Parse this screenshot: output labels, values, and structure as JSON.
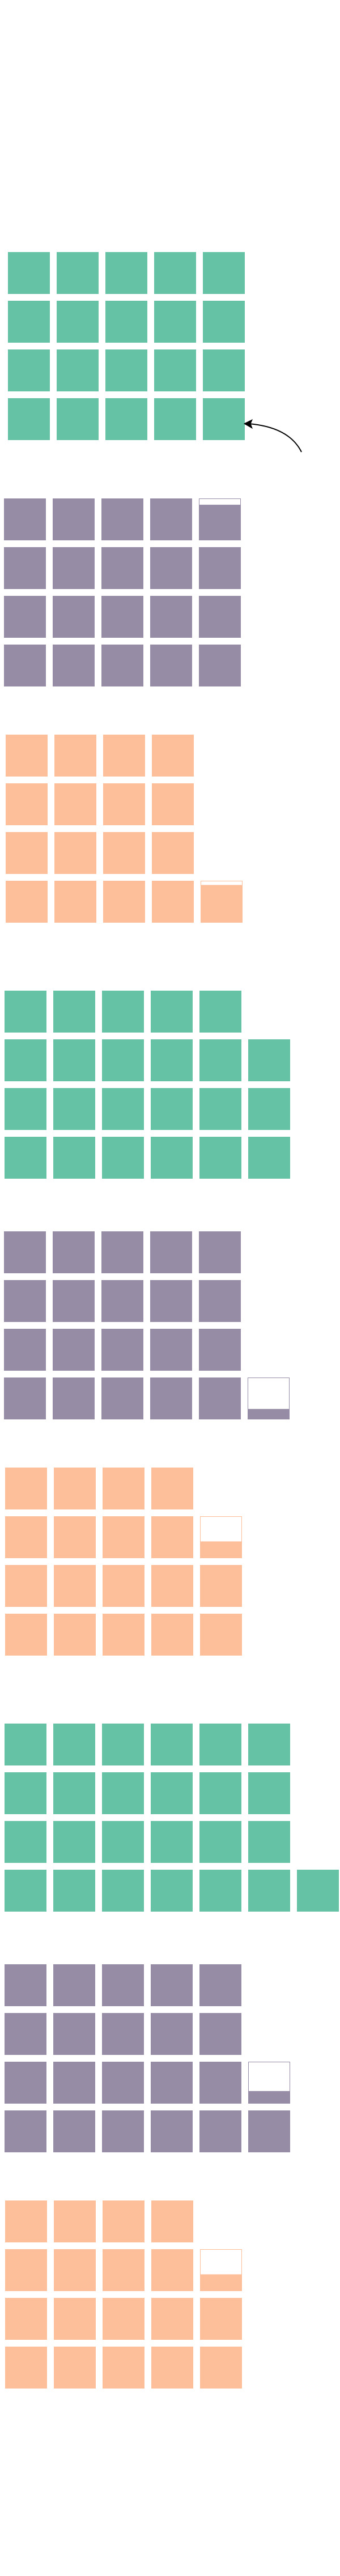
{
  "colors": {
    "green": "#66c2a5",
    "purple": "#968ca6",
    "orange": "#fdbf99",
    "empty": "#ffffff",
    "background": "#ffffff",
    "arrow": "#000000"
  },
  "icons": [
    "curved-arrow-icon"
  ],
  "chart_data": [
    {
      "type": "waffle",
      "color": "green",
      "rows": [
        5,
        5,
        5,
        5
      ],
      "partial": null
    },
    {
      "type": "waffle",
      "color": "purple",
      "rows": [
        5,
        5,
        5,
        5
      ],
      "partial": {
        "row": 0,
        "col": 4,
        "fill": 0.85
      }
    },
    {
      "type": "waffle",
      "color": "orange",
      "rows": [
        4,
        4,
        4,
        5
      ],
      "partial": {
        "row": 3,
        "col": 4,
        "fill": 0.9
      }
    },
    {
      "type": "waffle",
      "color": "green",
      "rows": [
        5,
        6,
        6,
        6
      ],
      "partial": null
    },
    {
      "type": "waffle",
      "color": "purple",
      "rows": [
        5,
        5,
        5,
        6
      ],
      "partial": {
        "row": 3,
        "col": 5,
        "fill": 0.25
      }
    },
    {
      "type": "waffle",
      "color": "orange",
      "rows": [
        4,
        5,
        5,
        5
      ],
      "partial": {
        "row": 1,
        "col": 4,
        "fill": 0.4
      }
    },
    {
      "type": "waffle",
      "color": "green",
      "rows": [
        6,
        6,
        6,
        7
      ],
      "partial": null
    },
    {
      "type": "waffle",
      "color": "purple",
      "rows": [
        5,
        5,
        6,
        6
      ],
      "partial": {
        "row": 2,
        "col": 5,
        "fill": 0.3
      }
    },
    {
      "type": "waffle",
      "color": "orange",
      "rows": [
        4,
        5,
        5,
        5
      ],
      "partial": {
        "row": 1,
        "col": 4,
        "fill": 0.4
      }
    }
  ]
}
